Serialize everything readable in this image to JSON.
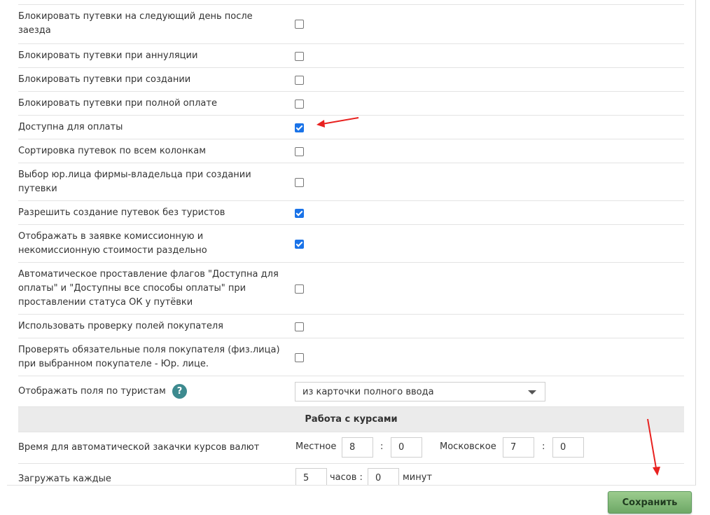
{
  "settings": [
    {
      "label": "Блокировать путевки на следующий день после заезда",
      "checked": false
    },
    {
      "label": "Блокировать путевки при аннуляции",
      "checked": false
    },
    {
      "label": "Блокировать путевки при создании",
      "checked": false
    },
    {
      "label": "Блокировать путевки при полной оплате",
      "checked": false
    },
    {
      "label": "Доступна для оплаты",
      "checked": true
    },
    {
      "label": "Сортировка путевок по всем колонкам",
      "checked": false
    },
    {
      "label": "Выбор юр.лица фирмы-владельца при создании путевки",
      "checked": false
    },
    {
      "label": "Разрешить создание путевок без туристов",
      "checked": true
    },
    {
      "label": "Отображать в заявке комиссионную и некомиссионную стоимости раздельно",
      "checked": true
    },
    {
      "label": "Автоматическое проставление флагов \"Доступна для оплаты\" и \"Доступны все способы оплаты\" при проставлении статуса ОК у путёвки",
      "checked": false
    },
    {
      "label": "Использовать проверку полей покупателя",
      "checked": false
    },
    {
      "label": "Проверять обязательные поля покупателя (физ.лица) при выбранном покупателе - Юр. лице.",
      "checked": false
    }
  ],
  "tourist_fields": {
    "label": "Отображать поля по туристам",
    "help": "?",
    "selected": "из карточки полного ввода"
  },
  "rates_section": {
    "title": "Работа с курсами",
    "auto_load_label": "Время для автоматической закачки курсов валют",
    "local_label": "Местное",
    "local_hours": "8",
    "local_minutes": "0",
    "moscow_label": "Московское",
    "moscow_hours": "7",
    "moscow_minutes": "0",
    "colon": ":",
    "load_every_label": "Загружать каждые",
    "every_hours": "5",
    "hours_label": "часов :",
    "every_minutes": "0",
    "minutes_label": "минут"
  },
  "save_label": "Сохранить",
  "colors": {
    "checkbox_checked": "#1a73e8",
    "arrow": "#e8211f",
    "save_button": "#7db56f",
    "help_icon": "#3d8a8f"
  }
}
